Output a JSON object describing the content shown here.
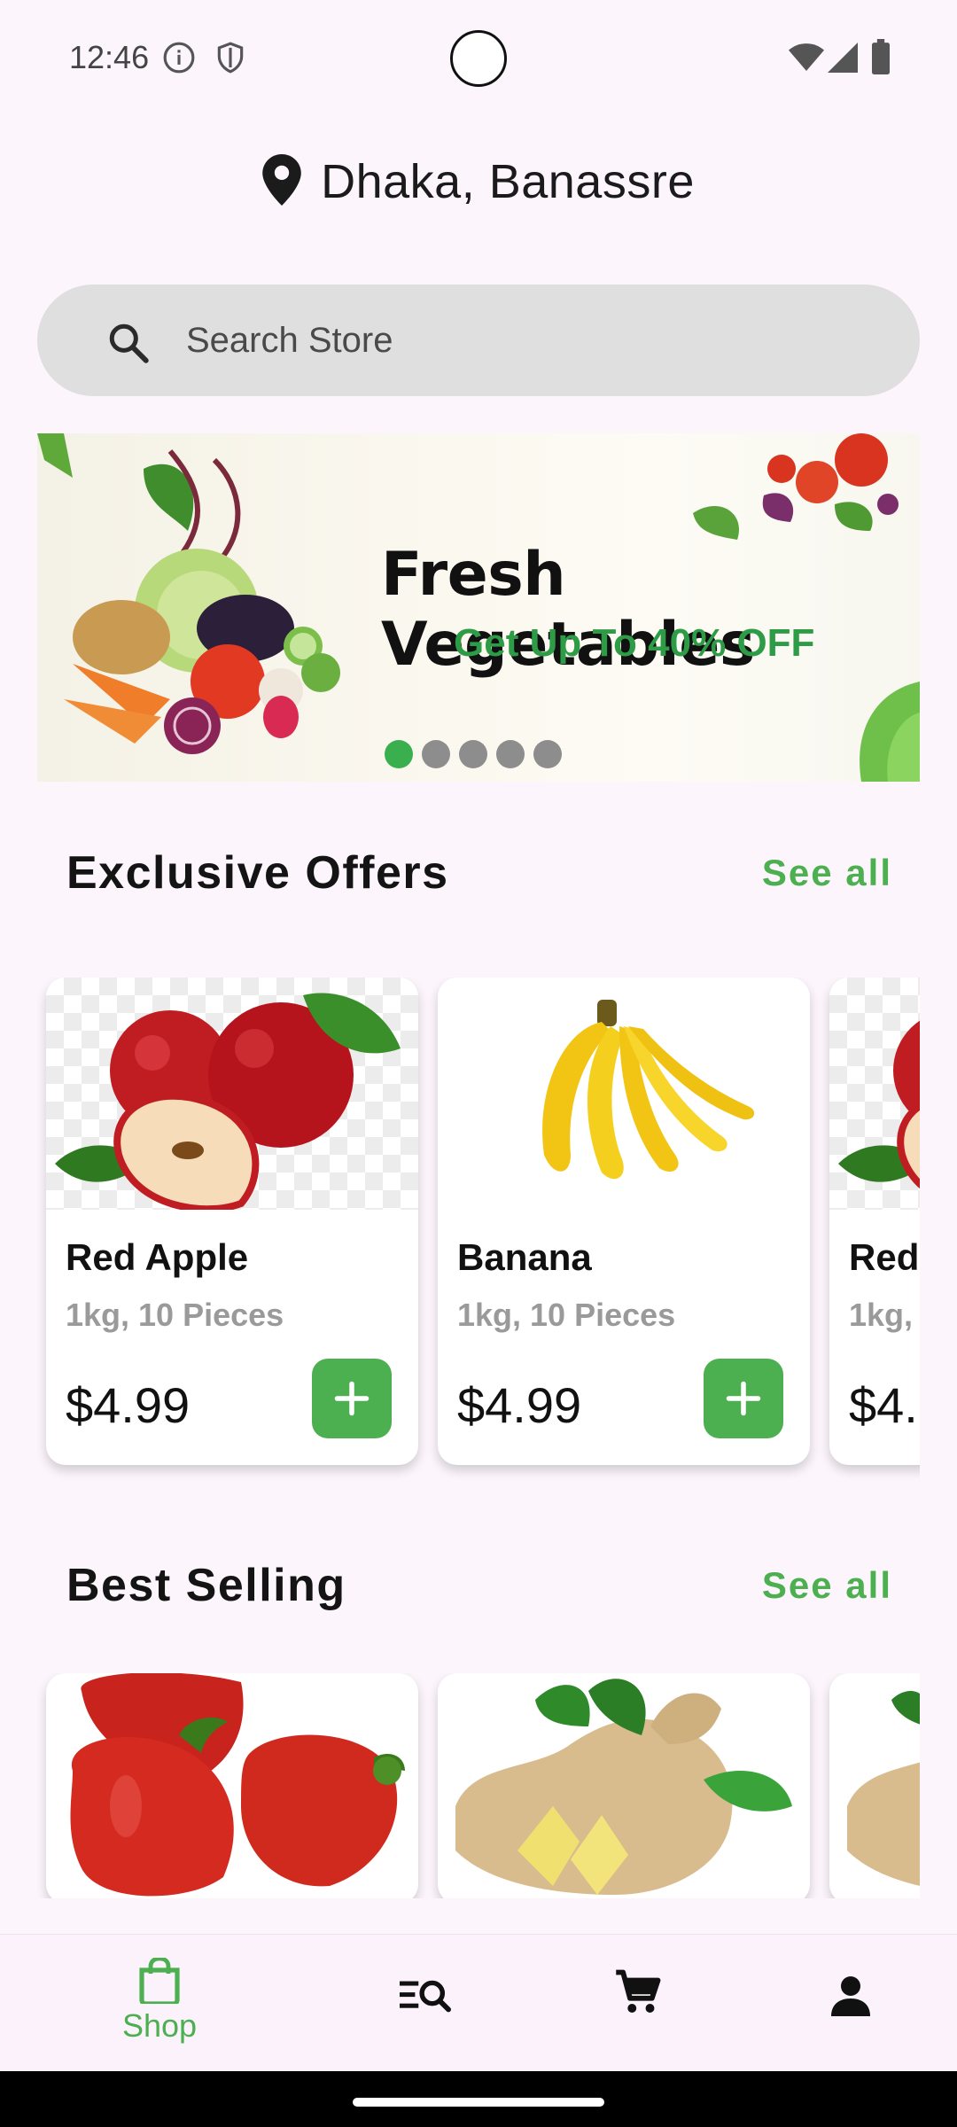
{
  "status_bar": {
    "time": "12:46"
  },
  "location": {
    "text": "Dhaka, Banassre"
  },
  "search": {
    "placeholder": "Search Store"
  },
  "banner": {
    "title": "Fresh Vegetables",
    "subtitle": "Get Up To 40% OFF",
    "page_count": 5,
    "active_index": 0
  },
  "exclusive_offers": {
    "title": "Exclusive Offers",
    "see_all": "See all",
    "items": [
      {
        "name": "Red Apple",
        "qty": "1kg, 10 Pieces",
        "price": "$4.99"
      },
      {
        "name": "Banana",
        "qty": "1kg, 10 Pieces",
        "price": "$4.99"
      },
      {
        "name": "Red",
        "qty": "1kg,",
        "price": "$4."
      }
    ]
  },
  "best_selling": {
    "title": "Best Selling",
    "see_all": "See all"
  },
  "bottom_nav": {
    "shop_label": "Shop"
  },
  "colors": {
    "accent": "#4caf50",
    "background": "#fcf6fc"
  }
}
